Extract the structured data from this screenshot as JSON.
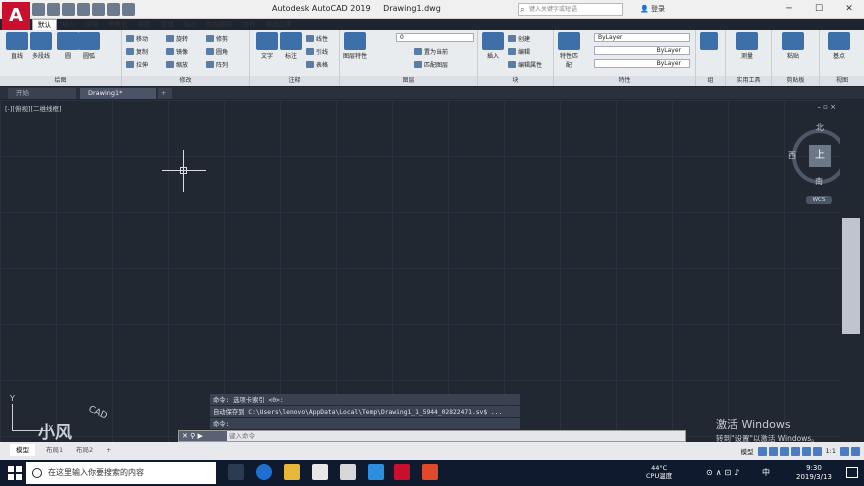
{
  "title_bar": {
    "app_title": "Autodesk AutoCAD 2019",
    "file_name": "Drawing1.dwg",
    "search_placeholder": "键入关键字或短语",
    "login_label": "登录",
    "logo_letter": "A"
  },
  "ribbon_tabs": [
    "默认",
    "插入",
    "注释",
    "参数化",
    "视图",
    "管理",
    "输出",
    "附加模块",
    "协作",
    "精选应用"
  ],
  "ribbon": {
    "draw": {
      "footer": "绘图",
      "tools": [
        "直线",
        "多段线",
        "圆",
        "圆弧"
      ]
    },
    "modify": {
      "footer": "修改",
      "tools": [
        "移动",
        "旋转",
        "修剪",
        "复制",
        "镜像",
        "圆角",
        "拉伸",
        "缩放",
        "阵列"
      ]
    },
    "annotation": {
      "footer": "注释",
      "tools": [
        "文字",
        "标注",
        "线性",
        "引线",
        "表格"
      ]
    },
    "layers": {
      "footer": "图层",
      "tools": [
        "图层特性",
        "置为当前",
        "匹配图层"
      ],
      "current_layer": "0"
    },
    "block": {
      "footer": "块",
      "tools": [
        "插入",
        "创建",
        "编辑",
        "编辑属性"
      ]
    },
    "properties": {
      "footer": "特性",
      "tools": [
        "特性匹配"
      ],
      "color": "ByLayer",
      "linetype": "ByLayer",
      "lineweight": "ByLayer"
    },
    "groups": {
      "footer": "组"
    },
    "utilities": {
      "footer": "实用工具",
      "tools": [
        "测量"
      ]
    },
    "clipboard": {
      "footer": "剪贴板",
      "tools": [
        "粘贴"
      ]
    },
    "view": {
      "footer": "视图",
      "tools": [
        "基点"
      ]
    }
  },
  "doc_tabs": [
    "开始",
    "Drawing1*"
  ],
  "drawing": {
    "viewport_label": "[-][俯视][二维线框]",
    "viewcube": {
      "top_face": "上",
      "north": "北",
      "south": "南",
      "east": "东",
      "west": "西",
      "wcs": "WCS"
    },
    "ucs": {
      "x": "X",
      "y": "Y"
    },
    "watermark": "小风",
    "watermark_small": "CAD"
  },
  "command": {
    "history": [
      "命令: 选项卡索引 <0>:",
      "自动保存到 C:\\Users\\lenovo\\AppData\\Local\\Temp\\Drawing1_1_5944_02822471.sv$ ...",
      "命令:"
    ],
    "input_placeholder": "键入命令"
  },
  "layout_tabs": [
    "模型",
    "布局1",
    "布局2"
  ],
  "status_bar": {
    "model_label": "模型",
    "scale": "1:1"
  },
  "windows_activation": {
    "line1": "激活 Windows",
    "line2": "转到\"设置\"以激活 Windows。"
  },
  "taskbar": {
    "search_placeholder": "在这里输入你要搜索的内容",
    "temperature": "44°C",
    "cpu_label": "CPU温度",
    "ime": "中",
    "time": "9:30",
    "date": "2019/3/13"
  },
  "colors": {
    "accent": "#c8102e",
    "canvas": "#222832",
    "taskbar": "#0f1a2e"
  }
}
